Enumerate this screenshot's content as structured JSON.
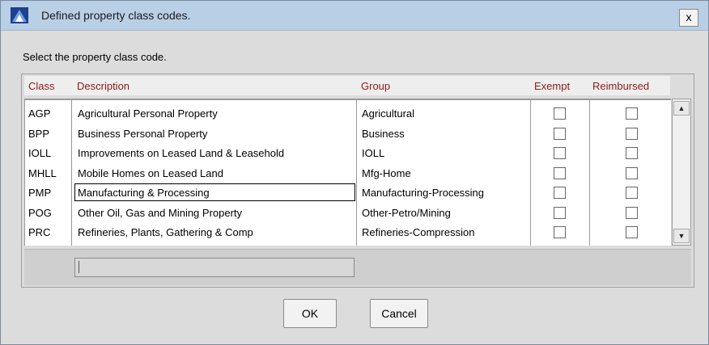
{
  "window": {
    "title": "Defined property class codes.",
    "close_label": "x"
  },
  "prompt": "Select the property class code.",
  "columns": [
    "Class",
    "Description",
    "Group",
    "Exempt",
    "Reimbursed"
  ],
  "rows": [
    {
      "class": "AGP",
      "description": "Agricultural Personal Property",
      "group": "Agricultural",
      "exempt": false,
      "reimbursed": false
    },
    {
      "class": "BPP",
      "description": "Business Personal Property",
      "group": "Business",
      "exempt": false,
      "reimbursed": false
    },
    {
      "class": "IOLL",
      "description": "Improvements on Leased Land & Leasehold",
      "group": "IOLL",
      "exempt": false,
      "reimbursed": false
    },
    {
      "class": "MHLL",
      "description": "Mobile Homes on Leased Land",
      "group": "Mfg-Home",
      "exempt": false,
      "reimbursed": false
    },
    {
      "class": "PMP",
      "description": "Manufacturing & Processing",
      "group": "Manufacturing-Processing",
      "exempt": false,
      "reimbursed": false
    },
    {
      "class": "POG",
      "description": "Other Oil, Gas and Mining Property",
      "group": "Other-Petro/Mining",
      "exempt": false,
      "reimbursed": false
    },
    {
      "class": "PRC",
      "description": "Refineries, Plants, Gathering & Comp",
      "group": "Refineries-Compression",
      "exempt": false,
      "reimbursed": false
    }
  ],
  "selected_row_index": 4,
  "edit_value": "",
  "buttons": {
    "ok": "OK",
    "cancel": "Cancel"
  },
  "scrollbar": {
    "up_icon": "▲",
    "down_icon": "▼"
  },
  "colors": {
    "header_text": "#8b1a1a",
    "titlebar": "#b9cfe6"
  }
}
